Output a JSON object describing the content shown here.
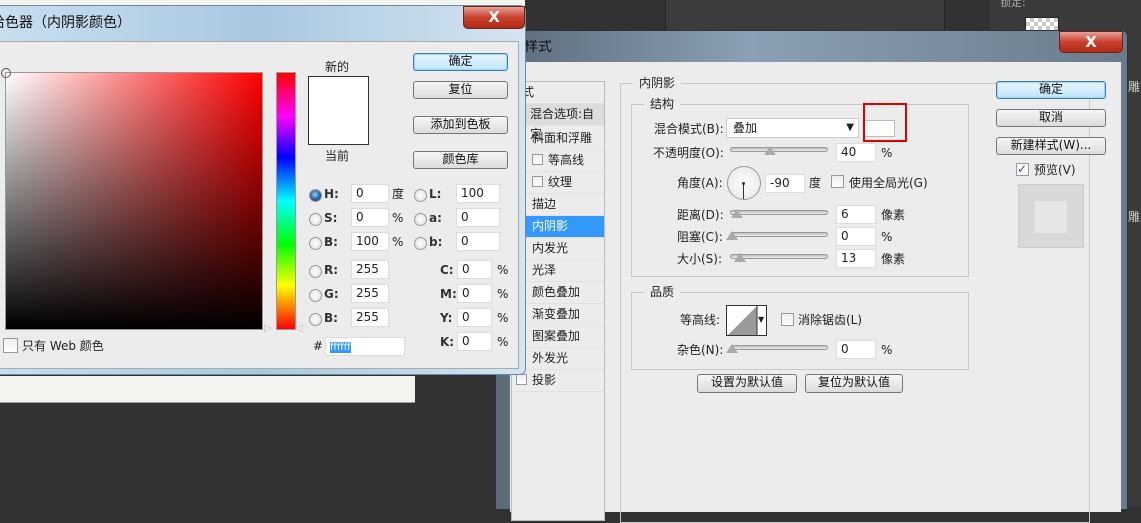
{
  "background_app": {
    "lock_label": "锁定:",
    "side_text": "雕"
  },
  "color_picker": {
    "title": "拾色器（内阴影颜色）",
    "close_label": "X",
    "new_label": "新的",
    "current_label": "当前",
    "new_color": "#ffffff",
    "current_color": "#ffffff",
    "buttons": {
      "ok": "确定",
      "reset": "复位",
      "add_swatch": "添加到色板",
      "color_library": "颜色库"
    },
    "fields": [
      {
        "label": "H:",
        "value": "0",
        "unit": "度",
        "selected": true
      },
      {
        "label": "S:",
        "value": "0",
        "unit": "%",
        "selected": false
      },
      {
        "label": "B:",
        "value": "100",
        "unit": "%",
        "selected": false
      },
      {
        "label": "R:",
        "value": "255",
        "unit": "",
        "selected": false
      },
      {
        "label": "G:",
        "value": "255",
        "unit": "",
        "selected": false
      },
      {
        "label": "B:",
        "value": "255",
        "unit": "",
        "selected": false
      }
    ],
    "lab_fields": [
      {
        "label": "L:",
        "value": "100"
      },
      {
        "label": "a:",
        "value": "0"
      },
      {
        "label": "b:",
        "value": "0"
      }
    ],
    "cmyk_fields": [
      {
        "label": "C:",
        "value": "0",
        "unit": "%"
      },
      {
        "label": "M:",
        "value": "0",
        "unit": "%"
      },
      {
        "label": "Y:",
        "value": "0",
        "unit": "%"
      },
      {
        "label": "K:",
        "value": "0",
        "unit": "%"
      }
    ],
    "hex_label": "#",
    "hex_value": "ffffff",
    "web_only_label": "只有 Web 颜色",
    "web_only_checked": false
  },
  "layer_style": {
    "title": "图层样式",
    "close_label": "X",
    "list_header": "样式",
    "blend_options": "混合选项:自定",
    "items": [
      {
        "label": "斜面和浮雕",
        "checkbox": false
      },
      {
        "label": "等高线",
        "checkbox": true
      },
      {
        "label": "纹理",
        "checkbox": true
      },
      {
        "label": "描边",
        "checkbox": false
      },
      {
        "label": "内阴影",
        "checkbox": false,
        "selected": true
      },
      {
        "label": "内发光",
        "checkbox": false
      },
      {
        "label": "光泽",
        "checkbox": false
      },
      {
        "label": "颜色叠加",
        "checkbox": false
      },
      {
        "label": "渐变叠加",
        "checkbox": false
      },
      {
        "label": "图案叠加",
        "checkbox": false
      },
      {
        "label": "外发光",
        "checkbox": false
      },
      {
        "label": "投影",
        "checkbox": true
      }
    ],
    "section_title": "内阴影",
    "structure": {
      "title": "结构",
      "blend_mode_label": "混合模式(B):",
      "blend_mode_value": "叠加",
      "shadow_color": "#ffffff",
      "opacity_label": "不透明度(O):",
      "opacity_value": "40",
      "opacity_unit": "%",
      "angle_label": "角度(A):",
      "angle_value": "-90",
      "angle_unit": "度",
      "global_light_label": "使用全局光(G)",
      "global_light_checked": false,
      "distance_label": "距离(D):",
      "distance_value": "6",
      "distance_unit": "像素",
      "choke_label": "阻塞(C):",
      "choke_value": "0",
      "choke_unit": "%",
      "size_label": "大小(S):",
      "size_value": "13",
      "size_unit": "像素"
    },
    "quality": {
      "title": "品质",
      "contour_label": "等高线:",
      "anti_alias_label": "消除锯齿(L)",
      "anti_alias_checked": false,
      "noise_label": "杂色(N):",
      "noise_value": "0",
      "noise_unit": "%"
    },
    "set_default": "设置为默认值",
    "reset_default": "复位为默认值",
    "ok": "确定",
    "cancel": "取消",
    "new_style": "新建样式(W)...",
    "preview_label": "预览(V)",
    "preview_checked": true
  }
}
